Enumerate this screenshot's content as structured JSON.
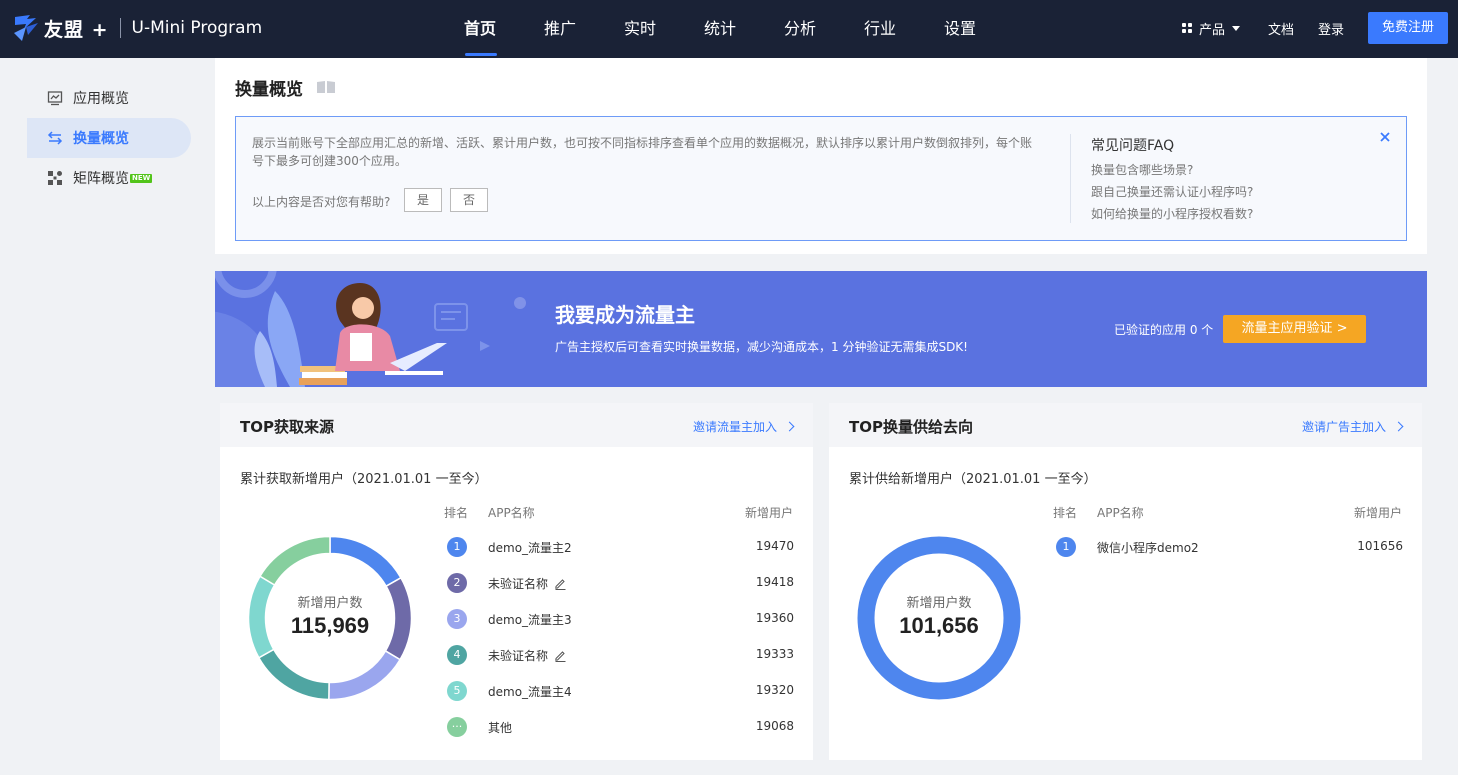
{
  "header": {
    "brand": "友盟 +",
    "product": "U-Mini Program",
    "nav": [
      "首页",
      "推广",
      "实时",
      "统计",
      "分析",
      "行业",
      "设置"
    ],
    "active_nav": "首页",
    "products_label": "产品",
    "docs_label": "文档",
    "login_label": "登录",
    "register_label": "免费注册"
  },
  "sidebar": {
    "items": [
      {
        "label": "应用概览",
        "icon": "chart-monitor-icon"
      },
      {
        "label": "换量概览",
        "icon": "swap-icon"
      },
      {
        "label": "矩阵概览",
        "icon": "matrix-icon",
        "badge": "NEW"
      }
    ],
    "active": "换量概览"
  },
  "overview": {
    "title": "换量概览",
    "description": "展示当前账号下全部应用汇总的新增、活跃、累计用户数，也可按不同指标排序查看单个应用的数据概况，默认排序以累计用户数倒叙排列，每个账号下最多可创建300个应用。",
    "helpful_question": "以上内容是否对您有帮助?",
    "yes_label": "是",
    "no_label": "否",
    "faq_title": "常见问题FAQ",
    "faq_items": [
      "换量包含哪些场景?",
      "跟自己换量还需认证小程序吗?",
      "如何给换量的小程序授权看数?"
    ]
  },
  "banner": {
    "title": "我要成为流量主",
    "subtitle": "广告主授权后可查看实时换量数据，减少沟通成本，1 分钟验证无需集成SDK!",
    "verified": "已验证的应用 0 个",
    "button": "流量主应用验证 >"
  },
  "panels": [
    {
      "title": "TOP获取来源",
      "link": "邀请流量主加入",
      "subtitle": "累计获取新增用户（2021.01.01 一至今）",
      "donut_label": "新增用户数",
      "donut_value": "115,969",
      "columns": [
        "排名",
        "APP名称",
        "新增用户"
      ],
      "rows": [
        {
          "rank": "1",
          "name": "demo_流量主2",
          "users": "19470",
          "color": "#4e86ee",
          "editable": false
        },
        {
          "rank": "2",
          "name": "未验证名称",
          "users": "19418",
          "color": "#6e6aa8",
          "editable": true
        },
        {
          "rank": "3",
          "name": "demo_流量主3",
          "users": "19360",
          "color": "#9aa6ee",
          "editable": false
        },
        {
          "rank": "4",
          "name": "未验证名称",
          "users": "19333",
          "color": "#4fa5a2",
          "editable": true
        },
        {
          "rank": "5",
          "name": "demo_流量主4",
          "users": "19320",
          "color": "#7fd7cf",
          "editable": false
        },
        {
          "rank": "···",
          "name": "其他",
          "users": "19068",
          "color": "#86cf9e",
          "editable": false
        }
      ]
    },
    {
      "title": "TOP换量供给去向",
      "link": "邀请广告主加入",
      "subtitle": "累计供给新增用户（2021.01.01 一至今）",
      "donut_label": "新增用户数",
      "donut_value": "101,656",
      "columns": [
        "排名",
        "APP名称",
        "新增用户"
      ],
      "rows": [
        {
          "rank": "1",
          "name": "微信小程序demo2",
          "users": "101656",
          "color": "#4e86ee",
          "editable": false
        }
      ]
    }
  ]
}
